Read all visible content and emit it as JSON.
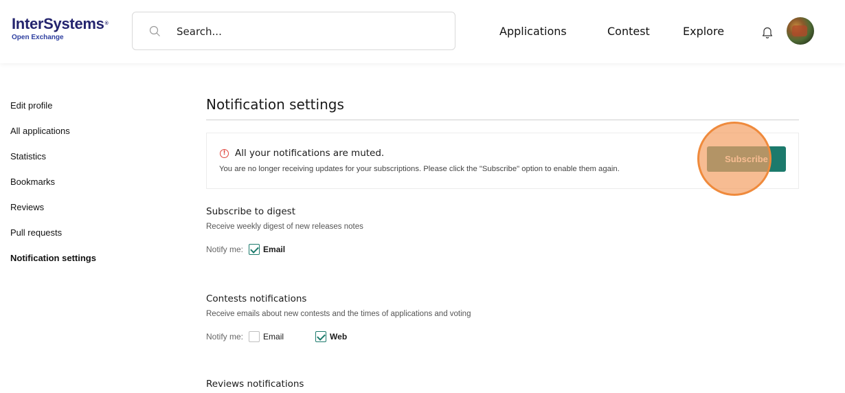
{
  "header": {
    "logo_main": "InterSystems",
    "logo_sup": "®",
    "logo_sub": "Open Exchange",
    "search_placeholder": "Search...",
    "nav": [
      "Applications",
      "Contest",
      "Explore"
    ]
  },
  "sidebar": {
    "items": [
      {
        "label": "Edit profile",
        "active": false
      },
      {
        "label": "All applications",
        "active": false
      },
      {
        "label": "Statistics",
        "active": false
      },
      {
        "label": "Bookmarks",
        "active": false
      },
      {
        "label": "Reviews",
        "active": false
      },
      {
        "label": "Pull requests",
        "active": false
      },
      {
        "label": "Notification settings",
        "active": true
      }
    ]
  },
  "main": {
    "title": "Notification settings",
    "alert": {
      "icon": "alert-circle-icon",
      "icon_glyph": "!",
      "title": "All your notifications are muted.",
      "text": "You are no longer receiving updates for your subscriptions. Please click the \"Subscribe\" option to enable them again.",
      "button": "Subscribe"
    },
    "sections": [
      {
        "title": "Subscribe to digest",
        "desc": "Receive weekly digest of new releases notes",
        "notify_label": "Notify me:",
        "options": [
          {
            "label": "Email",
            "checked": true
          }
        ]
      },
      {
        "title": "Contests notifications",
        "desc": "Receive emails about new contests and the times of applications and voting",
        "notify_label": "Notify me:",
        "options": [
          {
            "label": "Email",
            "checked": false
          },
          {
            "label": "Web",
            "checked": true
          }
        ]
      },
      {
        "title": "Reviews notifications"
      }
    ]
  },
  "colors": {
    "brand_navy": "#24246e",
    "accent_teal": "#1c7a6c",
    "alert_red": "#e0443c",
    "click_highlight": "#ef8a3c"
  }
}
